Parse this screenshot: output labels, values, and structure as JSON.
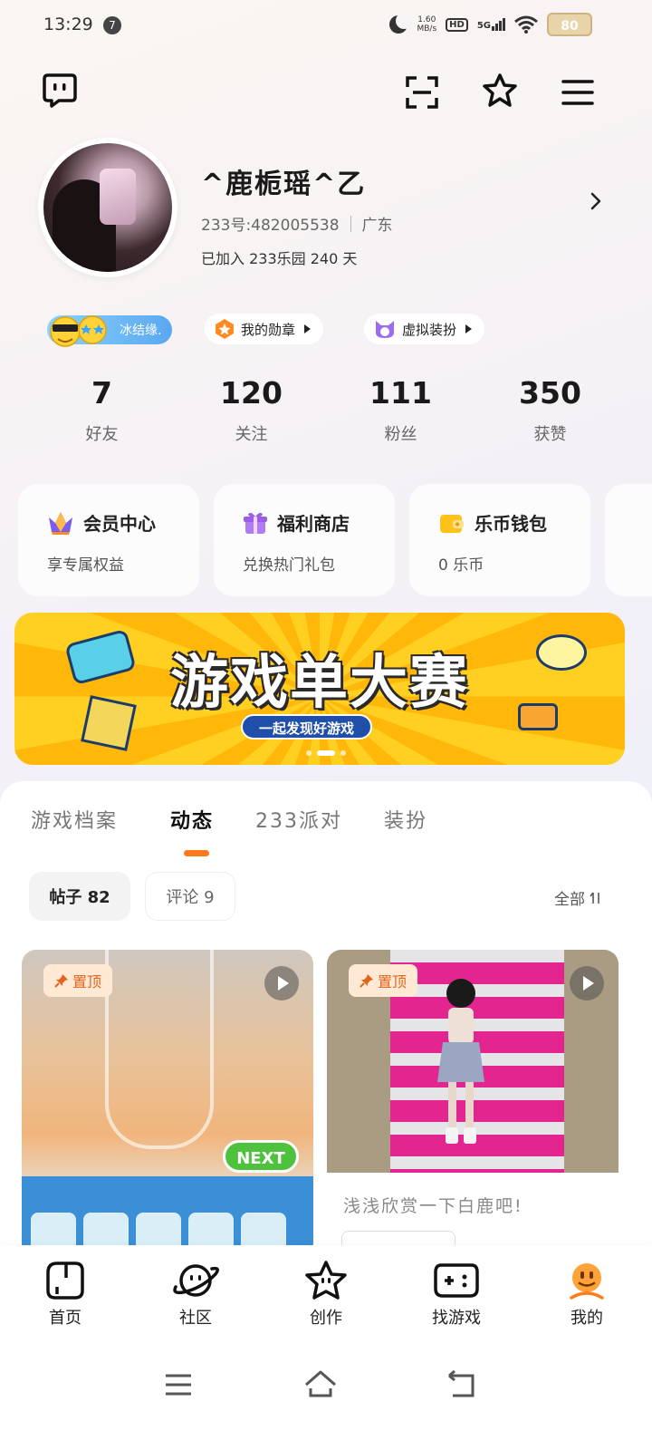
{
  "status_bar": {
    "time": "13:29",
    "notification_count": "7",
    "net_speed_value": "1.60",
    "net_speed_unit": "MB/s",
    "hd_label": "HD",
    "network": "5G",
    "battery": "80"
  },
  "profile": {
    "username": "^鹿栀瑶^乙",
    "uid": "233号:482005538",
    "region": "广东",
    "joined": "已加入 233乐园 240 天"
  },
  "chips": {
    "guild": "冰结缘.",
    "badges": "我的勋章",
    "outfit": "虚拟装扮"
  },
  "stats": [
    {
      "value": "7",
      "label": "好友"
    },
    {
      "value": "120",
      "label": "关注"
    },
    {
      "value": "111",
      "label": "粉丝"
    },
    {
      "value": "350",
      "label": "获赞"
    }
  ],
  "cards": [
    {
      "title": "会员中心",
      "subtitle": "享专属权益",
      "icon": "crown-icon"
    },
    {
      "title": "福利商店",
      "subtitle": "兑换热门礼包",
      "icon": "gift-icon"
    },
    {
      "title": "乐币钱包",
      "subtitle": "0 乐币",
      "icon": "wallet-icon"
    }
  ],
  "banner": {
    "title": "游戏单大赛",
    "subtitle": "一起发现好游戏"
  },
  "tabs": [
    "游戏档案",
    "动态",
    "233派对",
    "装扮"
  ],
  "active_tab": "动态",
  "filters": {
    "posts": "帖子 82",
    "comments": "评论 9",
    "all": "全部"
  },
  "feed": [
    {
      "pin_label": "置顶",
      "overlay_button": "NEXT"
    },
    {
      "pin_label": "置顶",
      "text": "浅浅欣赏一下白鹿吧!"
    }
  ],
  "bottom_nav": [
    {
      "label": "首页",
      "icon": "home-icon"
    },
    {
      "label": "社区",
      "icon": "planet-icon"
    },
    {
      "label": "创作",
      "icon": "star-icon"
    },
    {
      "label": "找游戏",
      "icon": "gamepad-icon"
    },
    {
      "label": "我的",
      "icon": "profile-icon"
    }
  ],
  "colors": {
    "accent": "#ff7a1a",
    "banner_yellow": "#ffc21a"
  }
}
